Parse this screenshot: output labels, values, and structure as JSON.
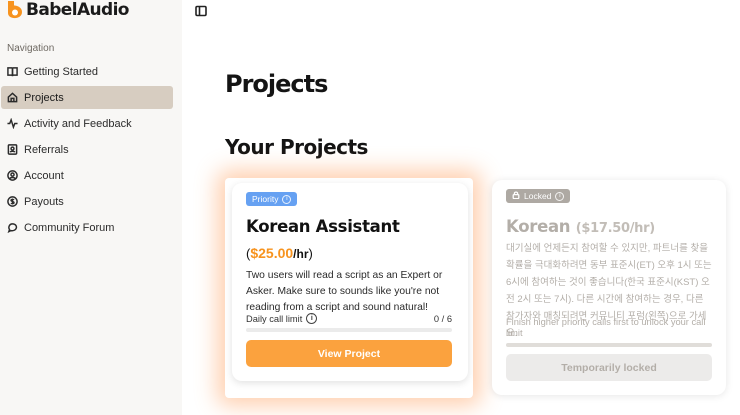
{
  "app": {
    "name": "BabelAudio",
    "logo_color": "#f7931e"
  },
  "sidebar": {
    "heading": "Navigation",
    "items": [
      {
        "label": "Getting Started",
        "icon": "book-icon",
        "active": false
      },
      {
        "label": "Projects",
        "icon": "home-icon",
        "active": true
      },
      {
        "label": "Activity and Feedback",
        "icon": "activity-icon",
        "active": false
      },
      {
        "label": "Referrals",
        "icon": "contacts-icon",
        "active": false
      },
      {
        "label": "Account",
        "icon": "user-circle-icon",
        "active": false
      },
      {
        "label": "Payouts",
        "icon": "dollar-circle-icon",
        "active": false
      },
      {
        "label": "Community Forum",
        "icon": "chat-bubble-icon",
        "active": false
      }
    ]
  },
  "main": {
    "title": "Projects",
    "section_title": "Your Projects",
    "projects": [
      {
        "badge": "Priority",
        "title": "Korean Assistant",
        "rate_open": "(",
        "rate": "$25.00",
        "rate_unit": "/hr",
        "rate_close": ")",
        "description": "Two users will read a script as an Expert or Asker. Make sure to sounds like you're not reading from a script and sound natural!",
        "limit_label": "Daily call limit",
        "limit_value": "0 / 6",
        "limit_progress": 0,
        "button": "View Project",
        "accent": "#f7931e"
      },
      {
        "badge": "Locked",
        "title": "Korean",
        "rate": "($17.50/hr)",
        "description": "대기실에 언제든지 참여할 수 있지만, 파트너를 찾을 확률을 극대화하려면 동부 표준시(ET) 오후 1시 또는 6시에 참여하는 것이 좋습니다(한국 표준시(KST) 오전 2시 또는 7시). 다른 시간에 참여하는 경우, 다른 참가자와 매칭되려면 커뮤니티 포럼(왼쪽)으로 가세요.",
        "hint": "Finish higher priority calls first to unlock your call limit",
        "button": "Temporarily locked"
      }
    ]
  }
}
